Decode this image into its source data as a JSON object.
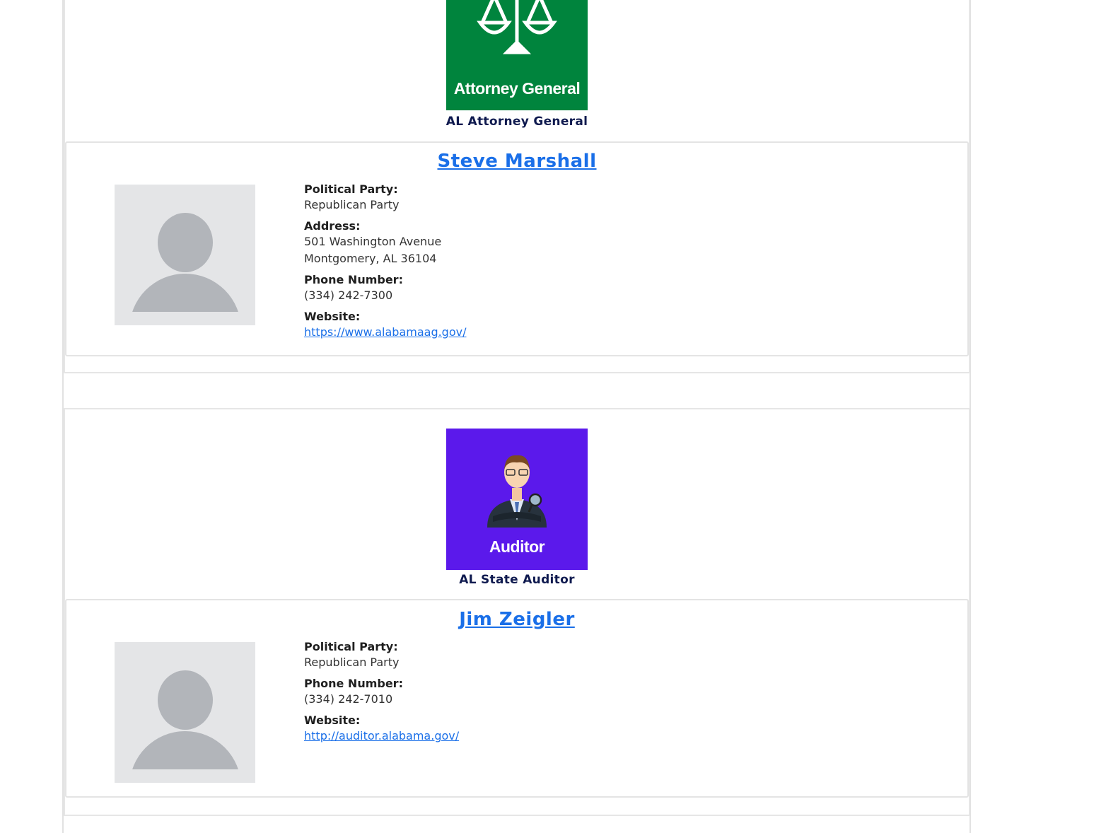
{
  "offices": [
    {
      "image_text": "Attorney General",
      "image_color": "#00843d",
      "image_icon": "scales-of-justice-icon",
      "office_title": "AL Attorney General",
      "person": {
        "name": "Steve Marshall",
        "political_party_label": "Political Party:",
        "political_party": "Republican Party",
        "address_label": "Address:",
        "address_line1": "501 Washington Avenue",
        "address_line2": "Montgomery, AL 36104",
        "phone_label": "Phone Number:",
        "phone": "(334) 242-7300",
        "website_label": "Website:",
        "website": "https://www.alabamaag.gov/"
      }
    },
    {
      "image_text": "Auditor",
      "image_color": "#5b19eb",
      "image_icon": "auditor-person-icon",
      "office_title": "AL State Auditor",
      "person": {
        "name": "Jim Zeigler",
        "political_party_label": "Political Party:",
        "political_party": "Republican Party",
        "phone_label": "Phone Number:",
        "phone": "(334) 242-7010",
        "website_label": "Website:",
        "website": "http://auditor.alabama.gov/"
      }
    }
  ]
}
